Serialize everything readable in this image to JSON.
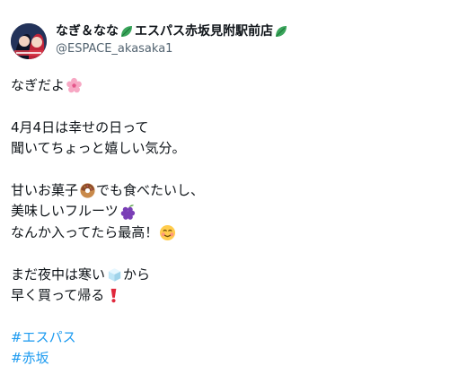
{
  "tweet": {
    "display_name_part1": "なぎ＆なな",
    "display_name_part2": "エスパス赤坂見附駅前店",
    "handle": "@ESPACE_akasaka1",
    "lines": {
      "l1": "なぎだよ",
      "l2": "4月4日は幸せの日って",
      "l3": "聞いてちょっと嬉しい気分。",
      "l4a": "甘いお菓子",
      "l4b": "でも食べたいし、",
      "l5": "美味しいフルーツ",
      "l6": "なんか入ってたら最高！",
      "l7a": "まだ夜中は寒い",
      "l7b": "から",
      "l8": "早く買って帰る"
    },
    "hashtags": [
      "#エスパス",
      "#赤坂"
    ]
  },
  "icons": {
    "name_icon": "green-leaf-icon",
    "emoji_1": "cherry-blossom-icon",
    "emoji_2": "doughnut-icon",
    "emoji_3": "grapes-icon",
    "emoji_4": "smiling-face-icon",
    "emoji_5": "ice-cube-icon",
    "emoji_6": "red-exclamation-icon"
  },
  "colors": {
    "hashtag": "#1d9bf0",
    "handle": "#536471",
    "text": "#0f1419"
  }
}
